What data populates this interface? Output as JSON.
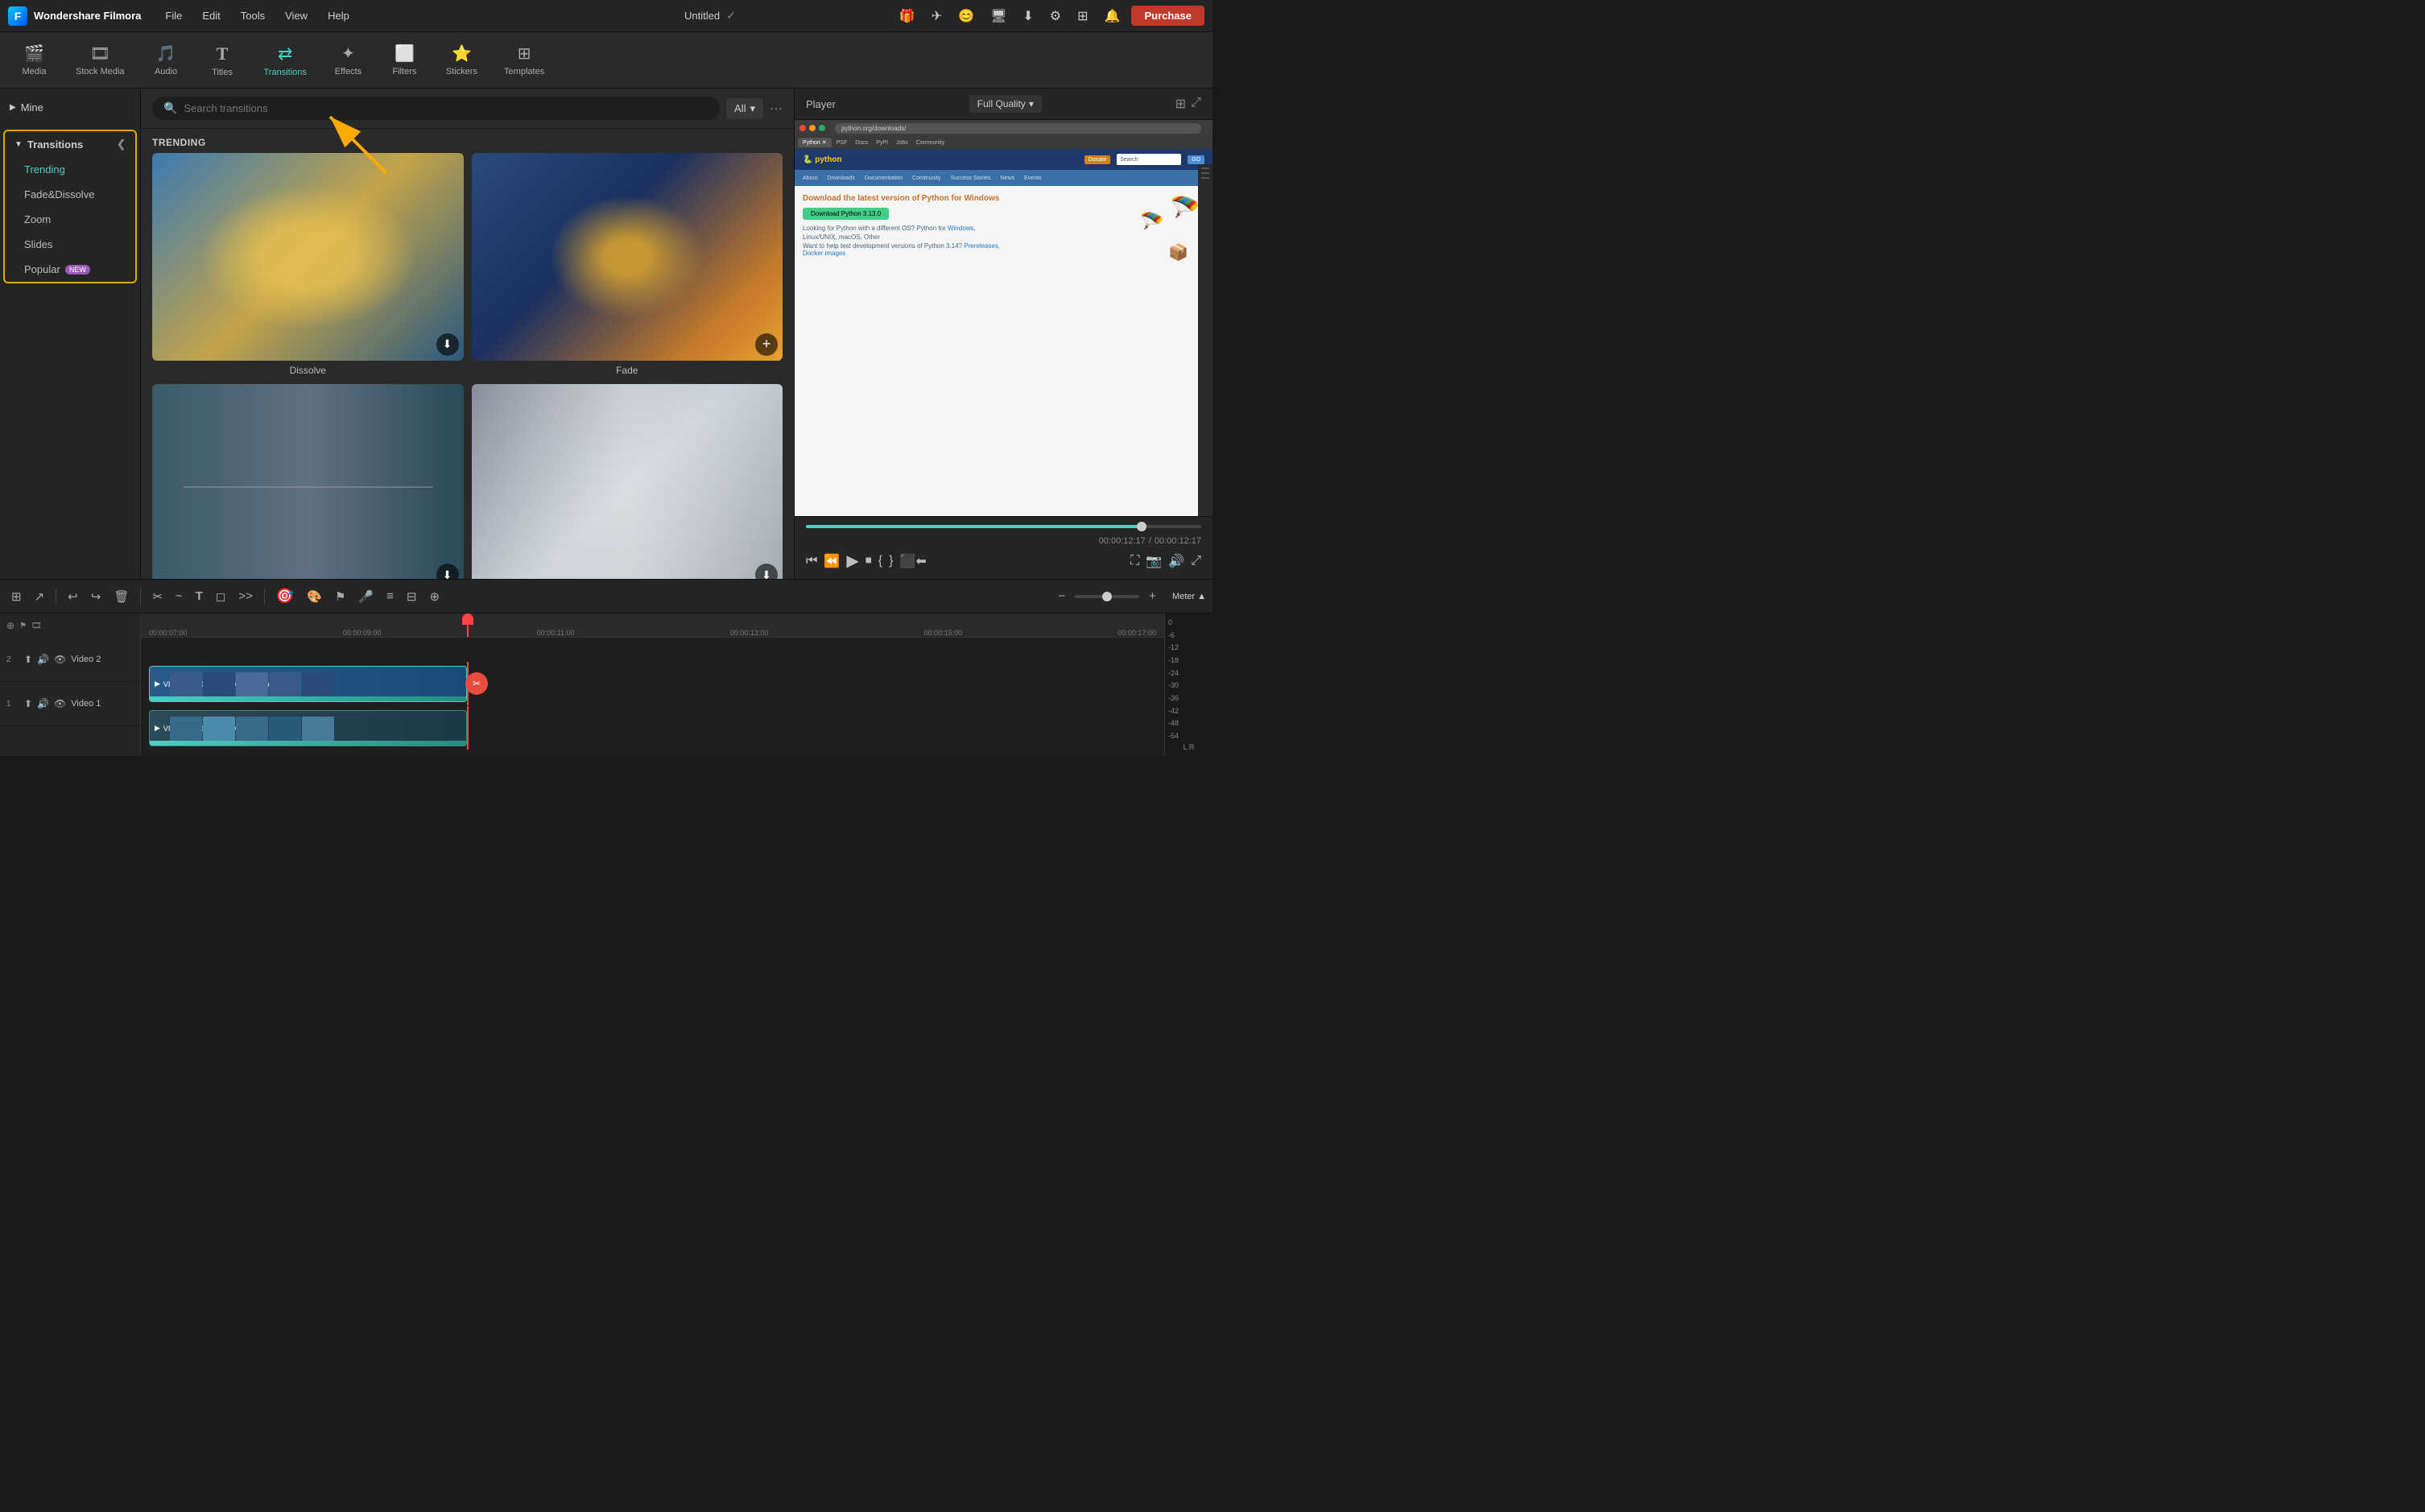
{
  "app": {
    "name": "Wondershare Filmora",
    "title": "Untitled"
  },
  "titlebar": {
    "menu_items": [
      "File",
      "Edit",
      "Tools",
      "View",
      "Help"
    ],
    "purchase_label": "Purchase"
  },
  "navbar": {
    "items": [
      {
        "id": "media",
        "label": "Media",
        "icon": "🎬"
      },
      {
        "id": "stock-media",
        "label": "Stock Media",
        "icon": "🎞"
      },
      {
        "id": "audio",
        "label": "Audio",
        "icon": "🎵"
      },
      {
        "id": "titles",
        "label": "Titles",
        "icon": "T"
      },
      {
        "id": "transitions",
        "label": "Transitions",
        "icon": "↔",
        "active": true
      },
      {
        "id": "effects",
        "label": "Effects",
        "icon": "✨"
      },
      {
        "id": "filters",
        "label": "Filters",
        "icon": "🔲"
      },
      {
        "id": "stickers",
        "label": "Stickers",
        "icon": "⭐"
      },
      {
        "id": "templates",
        "label": "Templates",
        "icon": "⊞"
      }
    ]
  },
  "sidebar": {
    "mine_label": "Mine",
    "transitions_label": "Transitions",
    "items": [
      {
        "label": "Trending",
        "active": true
      },
      {
        "label": "Fade&Dissolve",
        "active": false
      },
      {
        "label": "Zoom",
        "active": false
      },
      {
        "label": "Slides",
        "active": false
      },
      {
        "label": "Popular",
        "active": false,
        "badge": "NEW"
      }
    ]
  },
  "search": {
    "placeholder": "Search transitions",
    "filter_label": "All"
  },
  "transitions_section": {
    "label": "TRENDING",
    "items": [
      {
        "id": "dissolve",
        "label": "Dissolve",
        "has_add": false,
        "has_download": true
      },
      {
        "id": "fade",
        "label": "Fade",
        "has_add": true,
        "has_download": false
      },
      {
        "id": "item3",
        "label": "",
        "has_add": false,
        "has_download": true
      },
      {
        "id": "item4",
        "label": "",
        "has_add": false,
        "has_download": true
      }
    ]
  },
  "player": {
    "label": "Player",
    "quality": "Full Quality",
    "time_current": "00:00:12:17",
    "time_total": "00:00:12:17",
    "progress_percent": 85,
    "browser": {
      "url": "python.org/downloads/",
      "tagline": "Download the latest version of Python for Windows",
      "download_btn": "Download Python 3.13.0",
      "donate_label": "Donate",
      "nav_items": [
        "About",
        "Downloads",
        "Documentation",
        "Community",
        "Success Stories",
        "News",
        "Events"
      ]
    }
  },
  "timeline": {
    "toolbar_icons": [
      "⊞",
      "✂",
      "↩",
      "↪",
      "🗑",
      "✂",
      "~",
      "T",
      "◻",
      ">>"
    ],
    "meter_label": "Meter ▲",
    "zoom_minus": "−",
    "zoom_plus": "+",
    "times": [
      "00:00:07:00",
      "00:00:09:00",
      "00:00:11:00",
      "00:00:13:00",
      "00:00:15:00",
      "00:00:17:00"
    ],
    "tracks": [
      {
        "num": "2",
        "name": "Video 2",
        "clip_label": "VID_20241010_063504_Camera"
      },
      {
        "num": "1",
        "name": "Video 1",
        "clip_label": "VID_20241010_063504_Screen Recorder"
      }
    ],
    "vu_labels": [
      "0",
      "-6",
      "-12",
      "-18",
      "-24",
      "-30",
      "-36",
      "-42",
      "-48",
      "-54"
    ],
    "vu_bottom": "L    R"
  },
  "icons": {
    "search": "🔍",
    "more": "⋯",
    "download": "⬇",
    "add": "+",
    "play": "▶",
    "pause": "⏸",
    "back": "⏮",
    "forward": "⏭",
    "step_back": "⏪",
    "stop": "⏹",
    "cut": "✂",
    "chevron_left": "❮",
    "chevron_down": "▾"
  }
}
